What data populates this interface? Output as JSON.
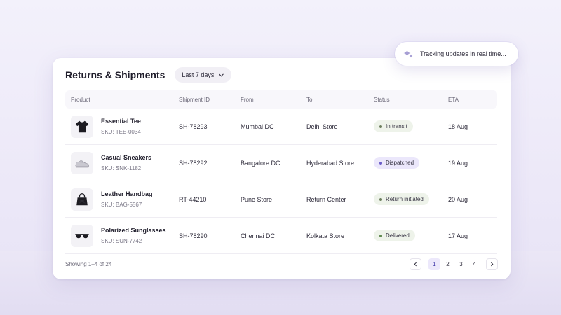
{
  "header": {
    "title": "Returns & Shipments",
    "range_label": "Last 7 days"
  },
  "toast": {
    "text": "Tracking updates in real time..."
  },
  "columns": [
    "Product",
    "Shipment ID",
    "From",
    "To",
    "Status",
    "ETA"
  ],
  "rows": [
    {
      "name": "Essential Tee",
      "sku": "SKU: TEE-0034",
      "icon": "tshirt-icon",
      "shipment_id": "SH-78293",
      "from": "Mumbai DC",
      "to": "Delhi Store",
      "status": "In transit",
      "status_bg": "#eef3ea",
      "status_dot": "#6b7d5c",
      "eta": "18 Aug"
    },
    {
      "name": "Casual Sneakers",
      "sku": "SKU: SNK-1182",
      "icon": "sneaker-icon",
      "shipment_id": "SH-78292",
      "from": "Bangalore DC",
      "to": "Hyderabad Store",
      "status": "Dispatched",
      "status_bg": "#ebe7fb",
      "status_dot": "#6a5cc8",
      "eta": "19 Aug"
    },
    {
      "name": "Leather Handbag",
      "sku": "SKU: BAG-5567",
      "icon": "handbag-icon",
      "shipment_id": "RT-44210",
      "from": "Pune Store",
      "to": "Return Center",
      "status": "Return initiated",
      "status_bg": "#eef3ea",
      "status_dot": "#6b7d5c",
      "eta": "20 Aug"
    },
    {
      "name": "Polarized Sunglasses",
      "sku": "SKU: SUN-7742",
      "icon": "sunglasses-icon",
      "shipment_id": "SH-78290",
      "from": "Chennai DC",
      "to": "Kolkata Store",
      "status": "Delivered",
      "status_bg": "#eef3ea",
      "status_dot": "#5f8a4f",
      "eta": "17 Aug"
    }
  ],
  "footer": {
    "showing": "Showing 1–4 of 24",
    "pages": [
      "1",
      "2",
      "3",
      "4"
    ],
    "active_page": "1"
  }
}
